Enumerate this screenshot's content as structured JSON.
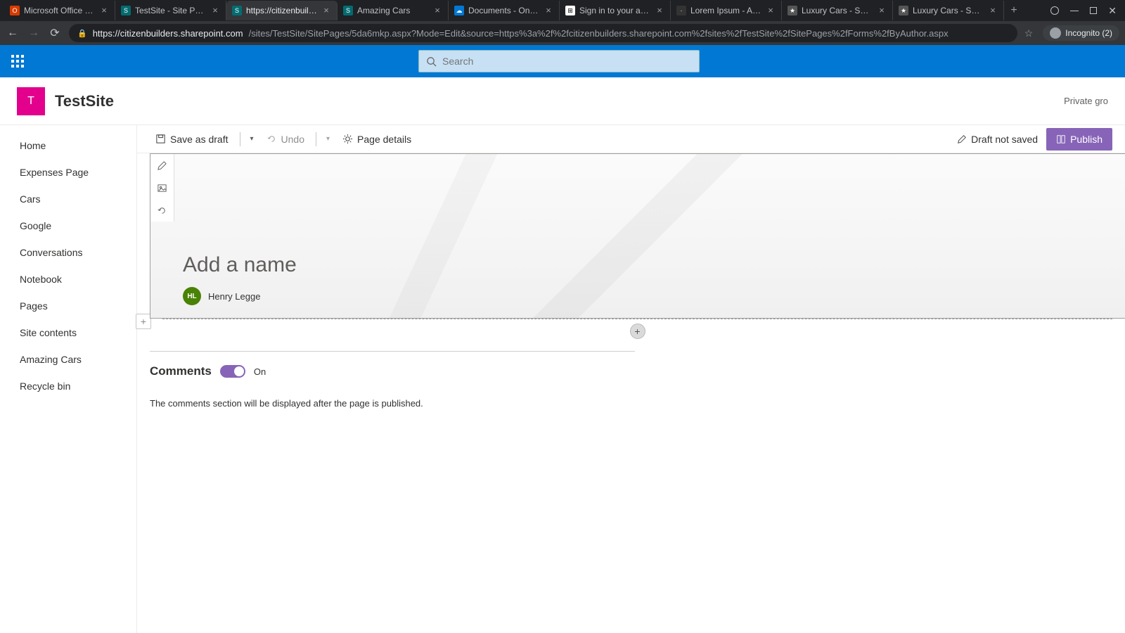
{
  "browser": {
    "tabs": [
      {
        "title": "Microsoft Office Home",
        "favicon": "O",
        "faviconBg": "#d83b01"
      },
      {
        "title": "TestSite - Site Pages - ",
        "favicon": "S",
        "faviconBg": "#036c70"
      },
      {
        "title": "https://citizenbuilders",
        "favicon": "S",
        "faviconBg": "#036c70",
        "active": true
      },
      {
        "title": "Amazing Cars",
        "favicon": "S",
        "faviconBg": "#036c70"
      },
      {
        "title": "Documents - OneDriv",
        "favicon": "☁",
        "faviconBg": "#0078d4"
      },
      {
        "title": "Sign in to your accoun",
        "favicon": "⊞",
        "faviconBg": "#ffffff"
      },
      {
        "title": "Lorem Ipsum - All the",
        "favicon": "·",
        "faviconBg": "#333"
      },
      {
        "title": "Luxury Cars - Sedans,",
        "favicon": "★",
        "faviconBg": "#555"
      },
      {
        "title": "Luxury Cars - Sedans,",
        "favicon": "★",
        "faviconBg": "#555"
      }
    ],
    "url_host": "https://citizenbuilders.sharepoint.com",
    "url_path": "/sites/TestSite/SitePages/5da6mkp.aspx?Mode=Edit&source=https%3a%2f%2fcitizenbuilders.sharepoint.com%2fsites%2fTestSite%2fSitePages%2fForms%2fByAuthor.aspx",
    "incognito_label": "Incognito (2)"
  },
  "suite": {
    "search_placeholder": "Search"
  },
  "site": {
    "logo_initial": "T",
    "title": "TestSite",
    "meta": "Private gro"
  },
  "leftnav": {
    "items": [
      "Home",
      "Expenses Page",
      "Cars",
      "Google",
      "Conversations",
      "Notebook",
      "Pages",
      "Site contents",
      "Amazing Cars",
      "Recycle bin"
    ]
  },
  "commandbar": {
    "save": "Save as draft",
    "undo": "Undo",
    "page_details": "Page details",
    "draft_status": "Draft not saved",
    "publish": "Publish"
  },
  "page": {
    "title_placeholder": "Add a name",
    "author_initials": "HL",
    "author_name": "Henry Legge"
  },
  "comments": {
    "heading": "Comments",
    "toggle_state": "On",
    "hint": "The comments section will be displayed after the page is published."
  }
}
